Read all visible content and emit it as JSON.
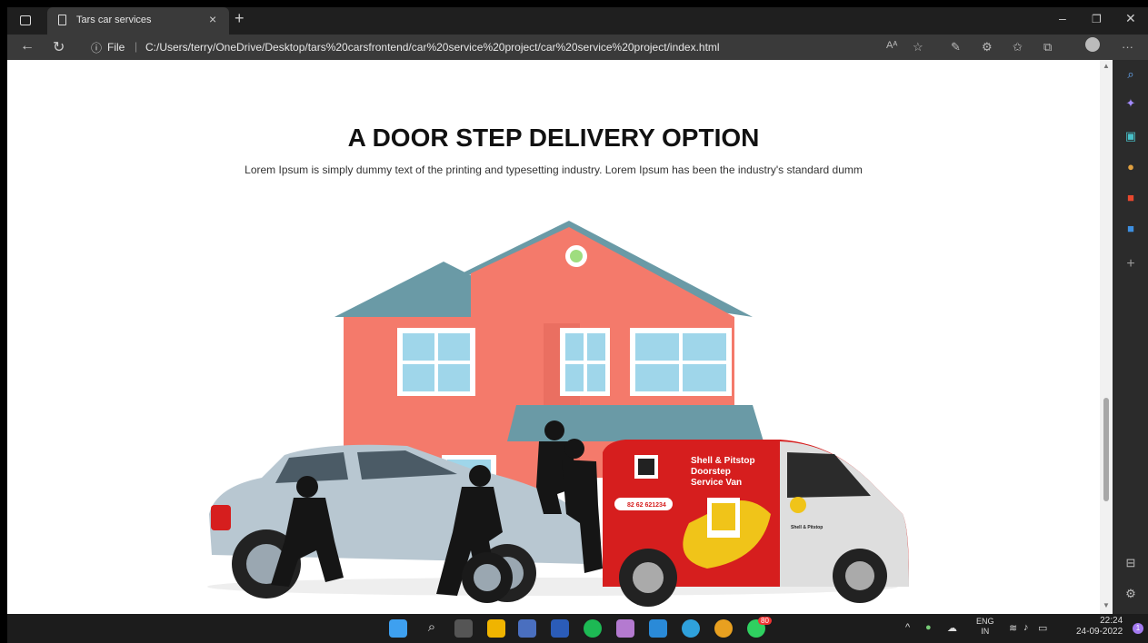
{
  "browser": {
    "tab_title": "Tars car services",
    "url_prefix": "File",
    "url": "C:/Users/terry/OneDrive/Desktop/tars%20carsfrontend/car%20service%20project/car%20service%20project/index.html"
  },
  "page": {
    "heading": "A DOOR STEP DELIVERY OPTION",
    "paragraph": "Lorem Ipsum is simply dummy text of the printing and typesetting industry. Lorem Ipsum has been the industry's standard dumm",
    "van": {
      "title_line1": "Shell & Pitstop",
      "title_line2": "Doorstep",
      "title_line3": "Service Van",
      "phone": "82 62 621234",
      "brand": "Shell & Pitstop"
    }
  },
  "taskbar": {
    "lang_top": "ENG",
    "lang_bottom": "IN",
    "time": "22:24",
    "date": "24-09-2022",
    "whatsapp_badge": "80",
    "notification_count": "1"
  },
  "colors": {
    "house_wall": "#f47a6b",
    "roof": "#6a9aa6",
    "van_red": "#d61e1e",
    "car_silver": "#b8c7d1",
    "edge_dark": "#1f1f1f"
  }
}
